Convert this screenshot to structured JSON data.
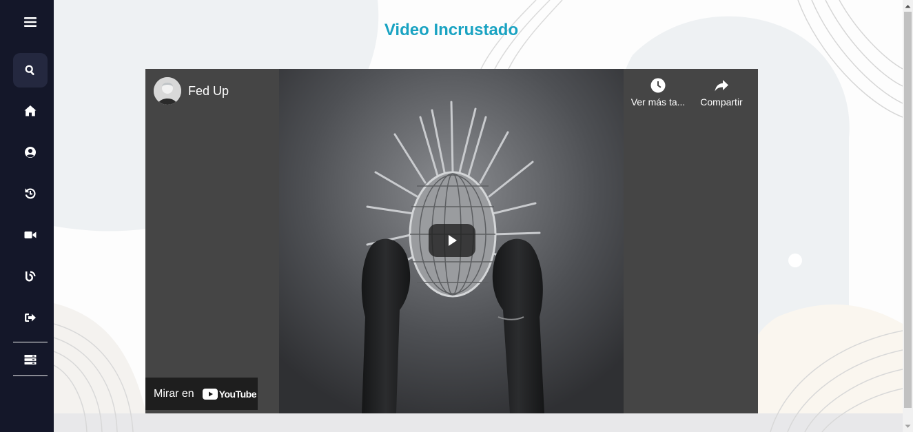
{
  "sidebar": {
    "items": [
      {
        "icon": "menu-icon"
      },
      {
        "icon": "search-icon",
        "active": true
      },
      {
        "icon": "home-icon"
      },
      {
        "icon": "user-circle-icon"
      },
      {
        "icon": "history-icon"
      },
      {
        "icon": "video-camera-icon"
      },
      {
        "icon": "blog-icon"
      },
      {
        "icon": "logout-icon"
      },
      {
        "icon": "server-icon"
      }
    ]
  },
  "page": {
    "title": "Video Incrustado"
  },
  "video": {
    "title": "Fed Up",
    "watch_later_label": "Ver más ta...",
    "share_label": "Compartir",
    "watch_on_label": "Mirar en",
    "youtube_word": "YouTube"
  },
  "colors": {
    "sidebar_bg": "#141729",
    "title_color": "#1aa3c2",
    "video_bg": "#454545"
  }
}
